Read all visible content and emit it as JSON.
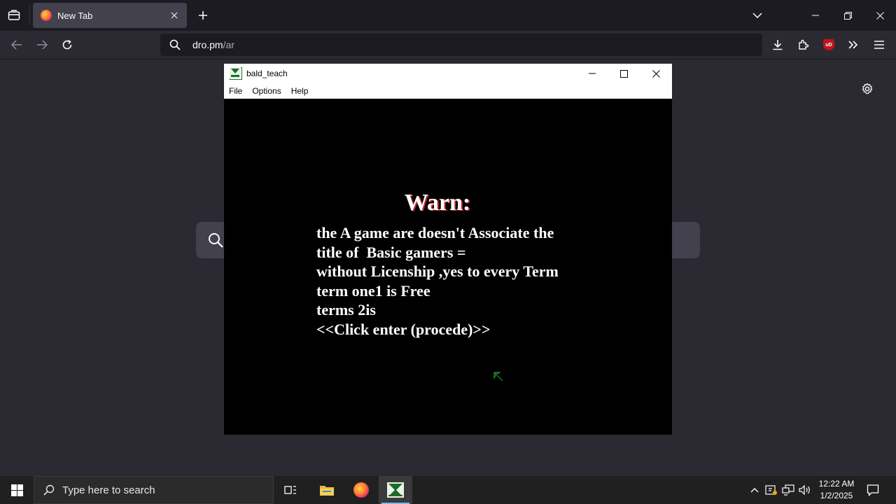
{
  "browser": {
    "tab": {
      "title": "New Tab"
    },
    "url": {
      "host": "dro.pm",
      "path": "/ar"
    }
  },
  "app_window": {
    "title": "bald_teach",
    "menu": [
      "File",
      "Options",
      "Help"
    ],
    "warning_title": "Warn:",
    "warning_lines": [
      "the A game are doesn't Associate the",
      "title of  Basic gamers =",
      "without Licenship ,yes to every Term",
      "term one1 is Free",
      "terms 2is",
      "<<Click enter (procede)>>"
    ]
  },
  "taskbar": {
    "search_placeholder": "Type here to search",
    "time": "12:22 AM",
    "date": "1/2/2025"
  },
  "colors": {
    "browser_bg": "#2b2a33",
    "tabbar_bg": "#1c1b22",
    "warning_shadow": "#c22a2a",
    "taskbar_bg": "#202020",
    "active_indicator": "#76b9ed"
  }
}
